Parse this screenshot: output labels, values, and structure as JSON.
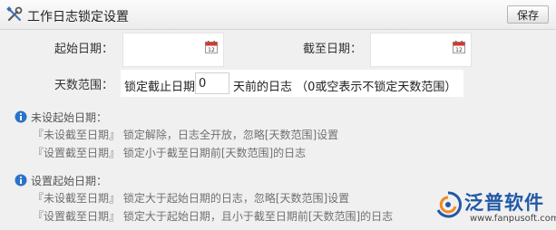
{
  "header": {
    "title": "工作日志锁定设置",
    "save_label": "保存"
  },
  "form": {
    "start_date_label": "起始日期：",
    "start_date_value": "",
    "end_date_label": "截至日期：",
    "end_date_value": "",
    "days_label": "天数范围：",
    "days_prefix": "锁定截止日期",
    "days_value": "0",
    "days_suffix": "天前的日志 （0或空表示不锁定天数范围）"
  },
  "help": [
    {
      "title": "未设起始日期：",
      "lines": [
        "『未设截至日期』 锁定解除，日志全开放，忽略[天数范围]设置",
        "『设置截至日期』 锁定小于截至日期前[天数范围]的日志"
      ]
    },
    {
      "title": "设置起始日期：",
      "lines": [
        "『未设截至日期』 锁定大于起始日期的日志，忽略[天数范围]设置",
        "『设置截至日期』 锁定大于起始日期，且小于截至日期前[天数范围]的日志"
      ]
    }
  ],
  "logo": {
    "name": "泛普软件",
    "url": "www.fanpusoft.com"
  },
  "colors": {
    "logo_blue": "#2158a8",
    "logo_orange": "#f08a1c",
    "info_blue": "#2a73c9",
    "calendar_red": "#d9362b"
  },
  "icons": {
    "header": "tools-icon",
    "calendar": "calendar-icon",
    "info": "info-icon",
    "logo": "fanpu-logo-icon"
  }
}
